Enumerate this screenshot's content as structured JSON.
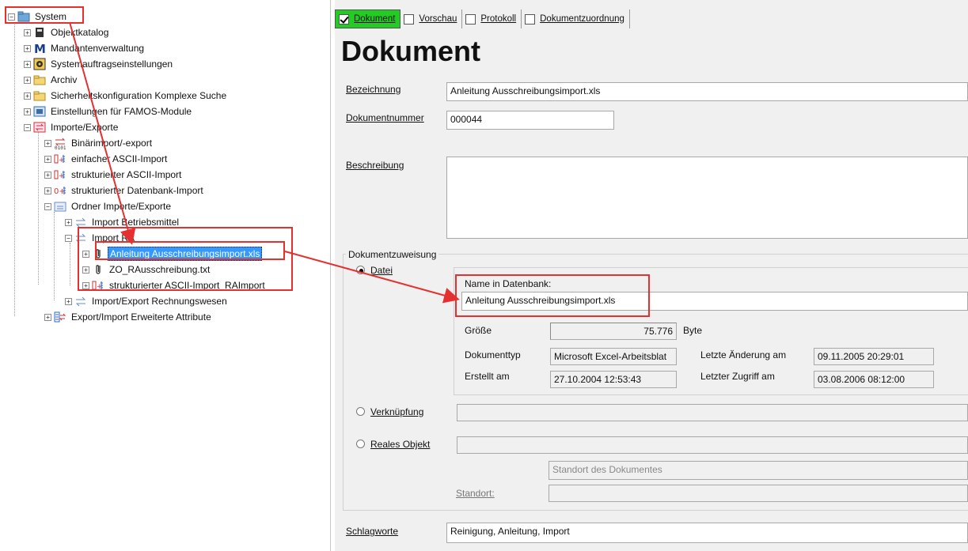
{
  "colors": {
    "annotation": "#e53030",
    "selection": "#3399ff",
    "active_tab": "#22cc22"
  },
  "tree": {
    "root": "System",
    "items": [
      "Objektkatalog",
      "Mandantenverwaltung",
      "Systemauftragseinstellungen",
      "Archiv",
      "Sicherheitskonfiguration Komplexe Suche",
      "Einstellungen für FAMOS-Module",
      "Importe/Exporte",
      "Binärimport/-export",
      "einfacher ASCII-Import",
      "strukturierter ASCII-Import",
      "strukturierter Datenbank-Import",
      "Ordner Importe/Exporte",
      "Import Betriebsmittel",
      "Import RA",
      "Anleitung Ausschreibungsimport.xls",
      "ZO_RAusschreibung.txt",
      "strukturierter ASCII-Import_RAImport",
      "Import/Export Rechnungswesen",
      "Export/Import Erweiterte Attribute"
    ]
  },
  "tabs": [
    "Dokument",
    "Vorschau",
    "Protokoll",
    "Dokumentzuordnung"
  ],
  "form": {
    "title": "Dokument",
    "bezeichnung_label": "Bezeichnung",
    "bezeichnung_value": "Anleitung Ausschreibungsimport.xls",
    "dokumentnummer_label": "Dokumentnummer",
    "dokumentnummer_value": "000044",
    "beschreibung_label": "Beschreibung",
    "beschreibung_value": "",
    "zuweisung_label": "Dokumentzuweisung",
    "datei_label": "Datei",
    "name_db_label": "Name in Datenbank:",
    "name_db_value": "Anleitung Ausschreibungsimport.xls",
    "groesse_label": "Größe",
    "groesse_value": "75.776",
    "groesse_unit": "Byte",
    "dokumenttyp_label": "Dokumenttyp",
    "dokumenttyp_value": "Microsoft Excel-Arbeitsblat",
    "erstellt_label": "Erstellt am",
    "erstellt_value": "27.10.2004 12:53:43",
    "aenderung_label": "Letzte Änderung am",
    "aenderung_value": "09.11.2005 20:29:01",
    "zugriff_label": "Letzter Zugriff am",
    "zugriff_value": "03.08.2006 08:12:00",
    "verknuepfung_label": "Verknüpfung",
    "verknuepfung_value": "",
    "reales_label": "Reales Objekt",
    "reales_value": "",
    "standort_placeholder": "Standort des Dokumentes",
    "standort_label": "Standort:",
    "standort_value": "",
    "schlagworte_label": "Schlagworte",
    "schlagworte_value": "Reinigung, Anleitung, Import"
  }
}
